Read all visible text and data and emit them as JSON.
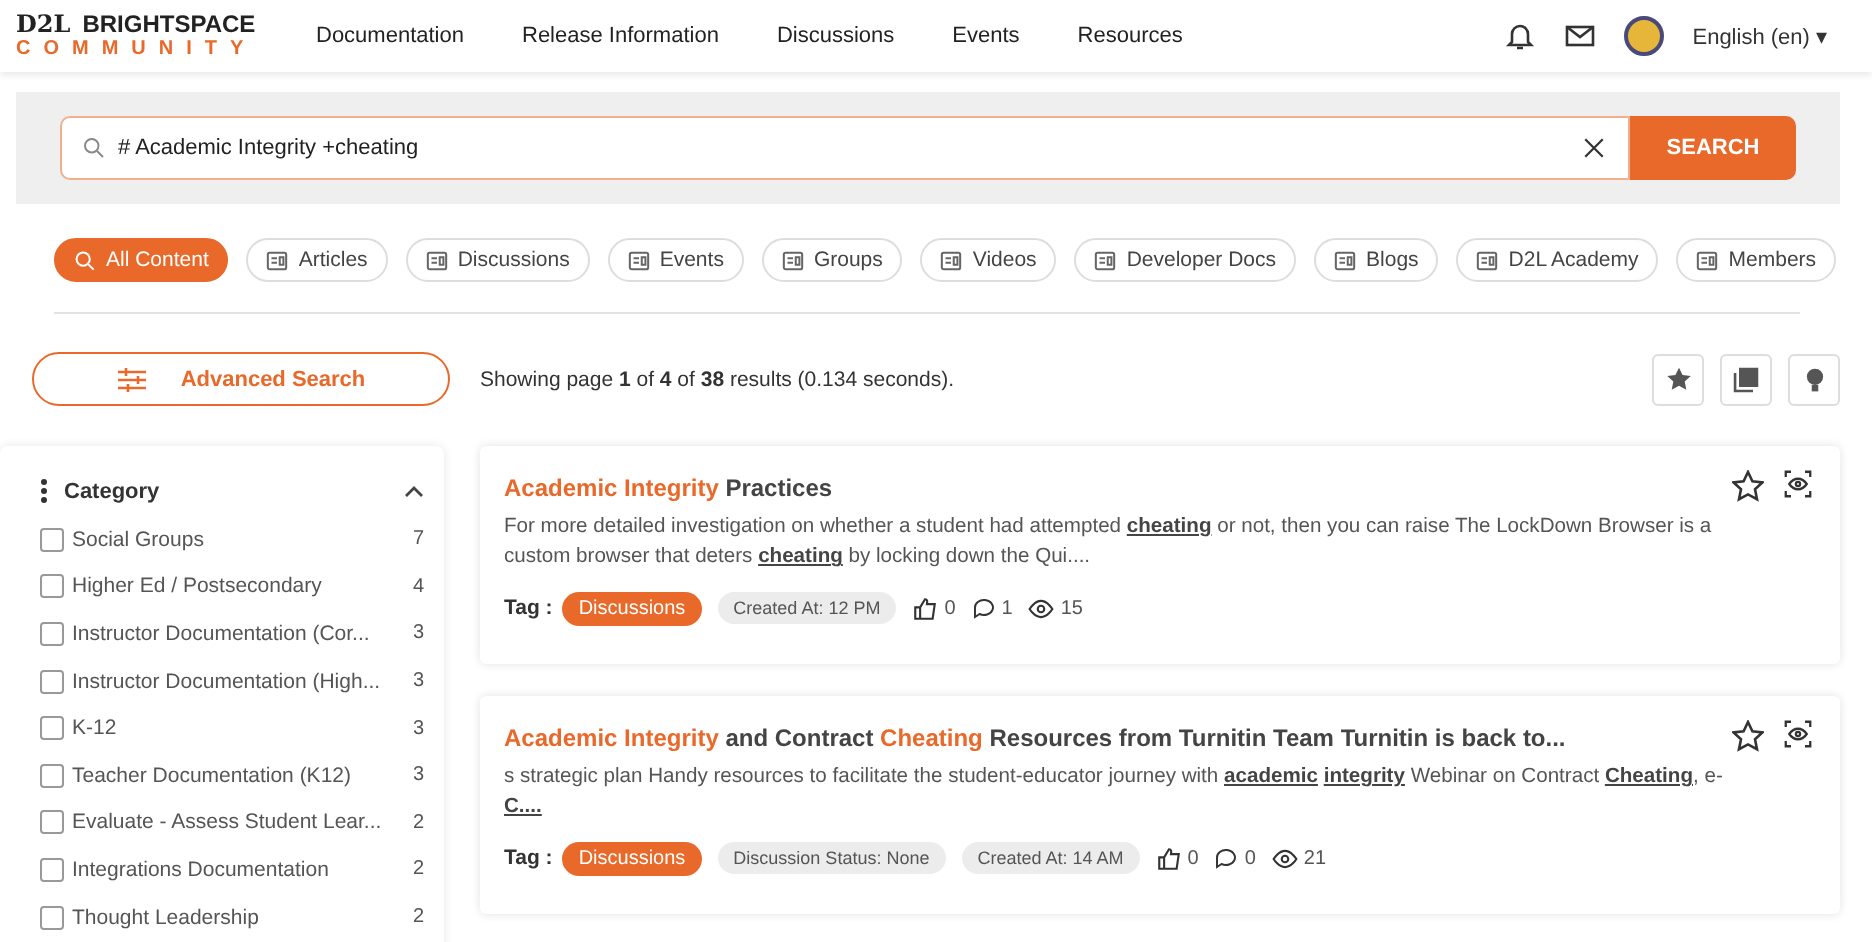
{
  "logo": {
    "brand": "D2L",
    "name": "BRIGHTSPACE",
    "sub": "COMMUNITY"
  },
  "nav": [
    "Documentation",
    "Release Information",
    "Discussions",
    "Events",
    "Resources"
  ],
  "language": "English (en)",
  "language_caret": "▾",
  "search": {
    "value": "# Academic Integrity +cheating",
    "button": "SEARCH"
  },
  "filters": [
    {
      "label": "All Content",
      "selected": true
    },
    {
      "label": "Articles",
      "selected": false
    },
    {
      "label": "Discussions",
      "selected": false
    },
    {
      "label": "Events",
      "selected": false
    },
    {
      "label": "Groups",
      "selected": false
    },
    {
      "label": "Videos",
      "selected": false
    },
    {
      "label": "Developer Docs",
      "selected": false
    },
    {
      "label": "Blogs",
      "selected": false
    },
    {
      "label": "D2L Academy",
      "selected": false
    },
    {
      "label": "Members",
      "selected": false
    }
  ],
  "advanced_search": "Advanced Search",
  "results_summary": "Showing page **1** of **4** of **38** results (0.134 seconds).",
  "sidebar": {
    "title": "Category",
    "expanded": true,
    "items": [
      {
        "label": "Social Groups",
        "count": "7",
        "checked": false
      },
      {
        "label": "Higher Ed / Postsecondary",
        "count": "4",
        "checked": false
      },
      {
        "label": "Instructor Documentation (Cor...",
        "count": "3",
        "checked": false
      },
      {
        "label": "Instructor Documentation (High...",
        "count": "3",
        "checked": false
      },
      {
        "label": "K-12",
        "count": "3",
        "checked": false
      },
      {
        "label": "Teacher Documentation (K12)",
        "count": "3",
        "checked": false
      },
      {
        "label": "Evaluate - Assess Student Lear...",
        "count": "2",
        "checked": false
      },
      {
        "label": "Integrations Documentation",
        "count": "2",
        "checked": false
      },
      {
        "label": "Thought Leadership",
        "count": "2",
        "checked": false
      }
    ]
  },
  "results": [
    {
      "title": [
        {
          "text": "Academic Integrity",
          "highlight": true
        },
        {
          "text": " Practices",
          "highlight": false
        }
      ],
      "snippet": "For more detailed investigation on whether a student had attempted **cheating** or not, then you can raise The LockDown Browser is a custom browser that deters **cheating** by locking down the Qui....",
      "tag_label": "Tag :",
      "tag": "Discussions",
      "chips": [
        "Created At: 12 PM"
      ],
      "likes": "0",
      "comments": "1",
      "views": "15"
    },
    {
      "title": [
        {
          "text": "Academic Integrity",
          "highlight": true
        },
        {
          "text": " and Contract ",
          "highlight": false
        },
        {
          "text": "Cheating",
          "highlight": true
        },
        {
          "text": " Resources from Turnitin Team Turnitin is back to...",
          "highlight": false
        }
      ],
      "snippet": "s strategic plan Handy resources to facilitate the student-educator journey with **academic** **integrity** Webinar on Contract **Cheating**, e-**C....**",
      "tag_label": "Tag :",
      "tag": "Discussions",
      "chips": [
        "Discussion Status: None",
        "Created At: 14 AM"
      ],
      "likes": "0",
      "comments": "0",
      "views": "21"
    }
  ]
}
